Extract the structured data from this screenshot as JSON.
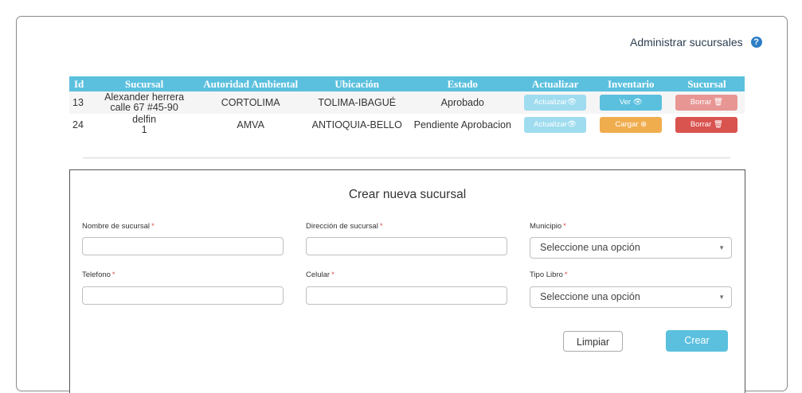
{
  "header": {
    "admin_link": "Administrar sucursales",
    "help_icon": "?"
  },
  "table": {
    "columns": [
      "Id",
      "Sucursal",
      "Autoridad Ambiental",
      "Ubicación",
      "Estado",
      "Actualizar",
      "Inventario",
      "Sucursal"
    ],
    "rows": [
      {
        "id": "13",
        "sucursal_line1": "Alexander herrera",
        "sucursal_line2": "calle 67 #45-90",
        "autoridad": "CORTOLIMA",
        "ubicacion": "TOLIMA-IBAGUÉ",
        "estado": "Aprobado",
        "actualizar": "Actualizar",
        "inventario": "Ver",
        "borrar": "Borrar"
      },
      {
        "id": "24",
        "sucursal_line1": "delfin",
        "sucursal_line2": "1",
        "autoridad": "AMVA",
        "ubicacion": "ANTIOQUIA-BELLO",
        "estado": "Pendiente Aprobacion",
        "actualizar": "Actualizar",
        "inventario": "Cargar",
        "borrar": "Borrar"
      }
    ]
  },
  "form": {
    "title": "Crear nueva sucursal",
    "required_mark": "*",
    "nombre_label": "Nombre de sucursal",
    "direccion_label": "Dirección de sucursal",
    "municipio_label": "Municipio",
    "municipio_value": "Seleccione una opción",
    "telefono_label": "Telefono",
    "celular_label": "Celular",
    "tipo_libro_label": "Tipo Libro",
    "tipo_libro_value": "Seleccione una opción",
    "limpiar_label": "Limpiar",
    "crear_label": "Crear"
  },
  "icons": {
    "eye": "eye-icon",
    "trash": "trash-icon",
    "plus_circle": "plus-circle-icon",
    "help": "help-icon",
    "caret": "caret-down-icon"
  },
  "colors": {
    "header_bg": "#5bc0de",
    "update_btn": "#9fdcef",
    "ver_btn": "#5bc0de",
    "cargar_btn": "#f0ad4e",
    "borrar_btn_1": "#e89694",
    "borrar_btn_2": "#d9534f"
  }
}
